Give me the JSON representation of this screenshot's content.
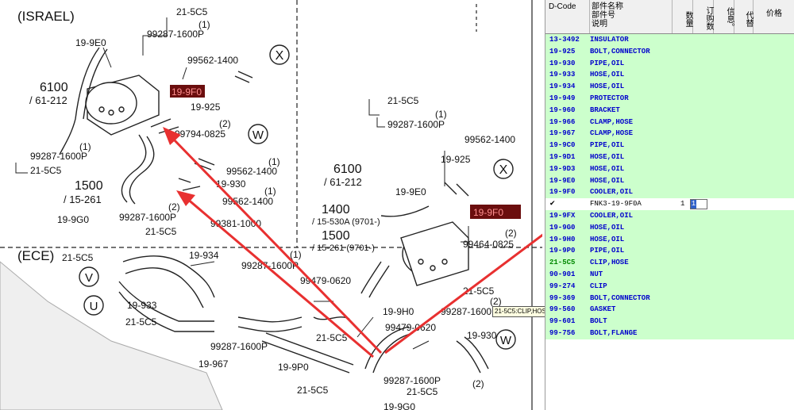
{
  "diagram": {
    "region_labels": [
      "(ISRAEL)",
      "(ECE)"
    ],
    "callout_w": "W",
    "callout_x": "X",
    "callout_v": "V",
    "callout_u": "U",
    "labels": [
      "21-5C5",
      "(1)",
      "99287-1600P",
      "19-9E0",
      "99562-1400",
      "6100",
      "/ 61-212",
      "19-9F0",
      "19-925",
      "(2)",
      "99794-0825",
      "99287-1600P",
      "(1)",
      "21-5C5",
      "99562-1400",
      "19-930",
      "(1)",
      "1500",
      "/ 15-261",
      "99562-1400",
      "19-9G0",
      "(2)",
      "99287-1600P",
      "21-5C5",
      "99381-1000",
      "(1)",
      "21-5C5",
      "(1)",
      "99287-1600P",
      "99562-1400",
      "19-925",
      "6100",
      "/ 61-212",
      "19-9E0",
      "19-9F0",
      "1400",
      "/ 15-530A (9701-)",
      "1500",
      "/ 15-261 (9701-)",
      "(2)",
      "99464-0825",
      "21-5C5",
      "19-934",
      "99287-1600P",
      "99479-0620",
      "(1)",
      "19-933",
      "21-5C5",
      "19-9H0",
      "99287-1600P",
      "21-5C5",
      "(2)",
      "99479-0620",
      "19-967",
      "99287-1600P",
      "21-5C5",
      "19-9P0",
      "19-930",
      "99287-1600P",
      "21-5C5",
      "21-5C5",
      "(2)",
      "19-9G0"
    ]
  },
  "tooltip": "21-5C5:CLIP,HOSE",
  "table": {
    "headers": {
      "dcode": "D-Code",
      "name": "部件名称",
      "partno": "部件号",
      "desc": "说明",
      "qty": "数量",
      "order": "订购数",
      "info": "信息。",
      "sub": "代替",
      "price": "价格"
    },
    "rows": [
      {
        "code": "13-3492",
        "name": "INSULATOR"
      },
      {
        "code": "19-925",
        "name": "BOLT,CONNECTOR"
      },
      {
        "code": "19-930",
        "name": "PIPE,OIL"
      },
      {
        "code": "19-933",
        "name": "HOSE,OIL"
      },
      {
        "code": "19-934",
        "name": "HOSE,OIL"
      },
      {
        "code": "19-949",
        "name": "PROTECTOR"
      },
      {
        "code": "19-960",
        "name": "BRACKET"
      },
      {
        "code": "19-966",
        "name": "CLAMP,HOSE"
      },
      {
        "code": "19-967",
        "name": "CLAMP,HOSE"
      },
      {
        "code": "19-9C0",
        "name": "PIPE,OIL"
      },
      {
        "code": "19-9D1",
        "name": "HOSE,OIL"
      },
      {
        "code": "19-9D3",
        "name": "HOSE,OIL"
      },
      {
        "code": "19-9E0",
        "name": "HOSE,OIL"
      },
      {
        "code": "19-9F0",
        "name": "COOLER,OIL"
      },
      {
        "code": "✔",
        "name": "FNK3-19-9F0A",
        "qty": "1",
        "order": "1",
        "selected": true
      },
      {
        "code": "19-9FX",
        "name": "COOLER,OIL"
      },
      {
        "code": "19-9G0",
        "name": "HOSE,OIL"
      },
      {
        "code": "19-9H0",
        "name": "HOSE,OIL"
      },
      {
        "code": "19-9P0",
        "name": "PIPE,OIL"
      },
      {
        "code": "21-5C5",
        "name": "CLIP,HOSE",
        "green": true
      },
      {
        "code": "90-901",
        "name": "NUT"
      },
      {
        "code": "99-274",
        "name": "CLIP"
      },
      {
        "code": "99-369",
        "name": "BOLT,CONNECTOR"
      },
      {
        "code": "99-560",
        "name": "GASKET"
      },
      {
        "code": "99-601",
        "name": "BOLT"
      },
      {
        "code": "99-756",
        "name": "BOLT,FLANGE"
      }
    ]
  },
  "colors": {
    "row_bg": "#ccffcc",
    "code_text": "#0000cc",
    "arrow": "#e83030",
    "highlight_box": "#6b0e0e"
  }
}
